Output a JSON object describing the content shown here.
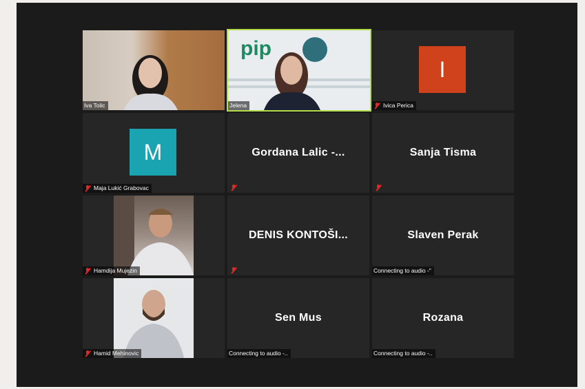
{
  "participants": [
    {
      "name": "Iva Tolic",
      "label": "Iva Tolic"
    },
    {
      "name": "Jelena",
      "label": "Jelena"
    },
    {
      "name": "Ivica Perica",
      "label": "Ivica Perica",
      "initial": "I",
      "avatar_color": "#d0421b"
    },
    {
      "name": "Maja Lukić Grabovac",
      "label": "Maja Lukić Grabovac",
      "initial": "M",
      "avatar_color": "#1aa3b0"
    },
    {
      "name": "Gordana  Lalic  -...",
      "display": "Gordana  Lalic  -..."
    },
    {
      "name": "Sanja Tisma",
      "display": "Sanja Tisma"
    },
    {
      "name": "Hamdija Mujezin",
      "label": "Hamdija Mujezin"
    },
    {
      "name": "DENIS  KONTOŠI...",
      "display": "DENIS  KONTOŠI..."
    },
    {
      "name": "Slaven Perak",
      "display": "Slaven Perak",
      "status": "Connecting to audio -\""
    },
    {
      "name": "Hamid Mehinovic",
      "label": "Hamid Mehinovic"
    },
    {
      "name": "Sen Mus",
      "display": "Sen Mus",
      "status": "Connecting to audio -.."
    },
    {
      "name": "Rozana",
      "display": "Rozana",
      "status": "Connecting to audio -.."
    }
  ],
  "colors": {
    "background": "#1b1b1b",
    "tile": "#262626",
    "active_speaker_border": "#b3dc4b",
    "muted_icon": "#e02828"
  },
  "icons": {
    "muted": "mic-muted-icon"
  }
}
